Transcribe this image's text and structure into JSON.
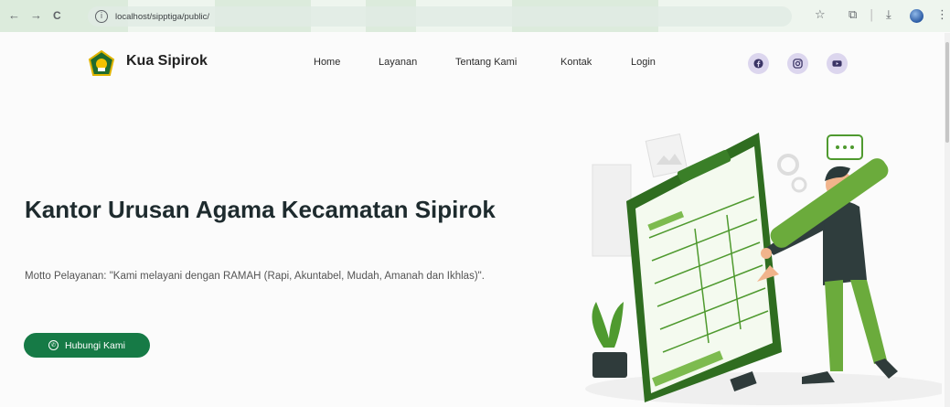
{
  "browser": {
    "url": "localhost/sipptiga/public/",
    "back_glyph": "←",
    "forward_glyph": "→",
    "reload_glyph": "C",
    "info_glyph": "i",
    "star_glyph": "☆",
    "extensions_glyph": "⧉",
    "download_glyph": "⤓",
    "menu_glyph": "⋮",
    "divider_glyph": "|"
  },
  "site": {
    "brand": "Kua Sipirok",
    "nav": [
      "Home",
      "Layanan",
      "Tentang Kami",
      "Kontak",
      "Login"
    ],
    "social_icons": [
      "facebook-icon",
      "instagram-icon",
      "youtube-icon"
    ]
  },
  "hero": {
    "title": "Kantor Urusan Agama Kecamatan Sipirok",
    "text": "Motto Pelayanan: \"Kami melayani dengan RAMAH (Rapi, Akuntabel, Mudah, Amanah dan Ikhlas)\".",
    "cta_label": "Hubungi Kami"
  },
  "colors": {
    "primary": "#167a46",
    "illustration_green": "#4f9a2f",
    "social_bg": "#dcd6ee",
    "social_fg": "#3b3566"
  }
}
